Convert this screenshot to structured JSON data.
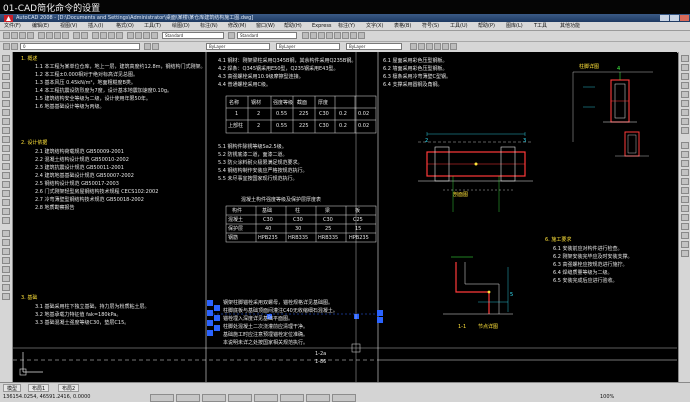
{
  "caption": "01-CAD简化命令的设置",
  "window": {
    "title": "AutoCAD 2008 - [D:\\Documents and Settings\\Administrator\\桌面\\某楼\\某仓库建筑结构施工图.dwg]"
  },
  "menu": {
    "items": [
      "文件(F)",
      "编辑(E)",
      "视图(V)",
      "插入(I)",
      "格式(O)",
      "工具(T)",
      "绘图(D)",
      "标注(N)",
      "修改(M)",
      "窗口(W)",
      "帮助(H)",
      "Express",
      "标注(Y)",
      "文字(X)",
      "表格(B)",
      "符号(S)",
      "工具(U)",
      "帮助(P)",
      "图库(L)",
      "T工具",
      "其他功能"
    ]
  },
  "toolbar": {
    "layer_combo": "0",
    "color_combo": "ByLayer",
    "linetype_combo": "ByLayer",
    "lineweight_combo": "ByLayer",
    "style_combo": "Standard"
  },
  "notes": {
    "section1": "1. 概述",
    "lines_left": [
      "1.1  本工程为某单位仓库，地上一层，建筑高度约12.8m，钢结构门式刚架。",
      "1.2  本工程±0.000相对于绝对标高详见总图。",
      "1.3  基本风压 0.45kN/m²，地面粗糙度B类。",
      "1.4  本工程抗震设防烈度为7度，设计基本地震加速度0.10g。",
      "1.5  建筑结构安全等级为二级，设计使用年限50年。",
      "1.6  地基基础设计等级为丙级。"
    ],
    "section2": "2. 设计依据",
    "lines_left2": [
      "2.1  建筑结构荷载规范 GB50009-2001",
      "2.2  混凝土结构设计规范 GB50010-2002",
      "2.3  建筑抗震设计规范 GB50011-2001",
      "2.4  建筑地基基础设计规范 GB50007-2002",
      "2.5  钢结构设计规范 GB50017-2003",
      "2.6  门式刚架轻型房屋钢结构技术规程 CECS102:2002",
      "2.7  冷弯薄壁型钢结构技术规范 GB50018-2002",
      "2.8  地质勘察报告"
    ],
    "section3": "3. 基础",
    "lines_left3": [
      "3.1  基础采用柱下独立基础，持力层为粉质粘土层。",
      "3.2  地基承载力特征值 fak=180kPa。",
      "3.3  基础混凝土强度等级C30，垫层C15。"
    ],
    "lines_mid": [
      "4.1  钢材：刚架梁柱采用Q345B钢，其余构件采用Q235B钢。",
      "4.2  焊条：Q345钢采用E50型，Q235钢采用E43型。",
      "4.3  高强螺栓采用10.9级摩擦型连接。",
      "4.4  普通螺栓采用C级。",
      "4.5  锚栓采用Q235钢。"
    ],
    "lines_mid2": [
      "5.1  钢构件除锈等级Sa2.5级。",
      "5.2  防锈底漆二道，面漆二道。",
      "5.3  防火涂料耐火极限满足规范要求。",
      "5.4  钢结构制作安装应严格按规范执行。",
      "5.5  未尽事宜按国家现行规范执行。"
    ],
    "lines_right": [
      "6.1  屋面采用彩色压型钢板。",
      "6.2  墙面采用彩色压型钢板。",
      "6.3  檩条采用冷弯薄壁C型钢。",
      "6.4  支撑采用圆钢及角钢。"
    ],
    "section_install": "6. 施工要求",
    "lines_install": [
      "6.1  安装前应对构件进行检查。",
      "6.2  刚架安装完毕应及时安装支撑。",
      "6.3  高强螺栓应按规范进行施拧。",
      "6.4  焊缝质量等级为二级。",
      "6.5  安装完成后应进行验收。"
    ],
    "table_headers": [
      "名称",
      "钢材",
      "强度等级",
      "截面",
      "厚度"
    ],
    "table_rows": [
      [
        "1",
        "2",
        "0.55",
        "225",
        "C30",
        "0.2",
        "0.02"
      ],
      [
        "上部柱",
        "2",
        "0.55",
        "225",
        "C30",
        "0.2",
        "0.02"
      ]
    ],
    "table2_title": "混凝土构件强度等级及保护层厚度表",
    "table2_headers": [
      "构件",
      "基础",
      "柱",
      "梁",
      "板"
    ],
    "table2_rows": [
      [
        "混凝土",
        "C30",
        "C30",
        "C30",
        "C25"
      ],
      [
        "保护层",
        "40",
        "30",
        "25",
        "15"
      ],
      [
        "钢筋",
        "HPB235",
        "HRB335",
        "HRB335",
        "HPB235"
      ]
    ],
    "detail_label_1": "1-1",
    "detail_label_2": "剖面图",
    "detail_label_3": "节点详图",
    "detail_label_4": "柱脚详图",
    "small_labels": [
      "2",
      "3",
      "4",
      "5"
    ],
    "selected_lines": [
      "钢架柱脚锚栓采用双螺母，锚栓规格详见基础图。",
      "柱脚底板与基础顶面间灌注C40无收缩细石混凝土。",
      "锚栓埋入深度详见基础平面图。",
      "柱脚处混凝土二次浇灌前应清理干净。",
      "基础施工时应注意预埋锚栓定位准确。",
      "本说明未详之处按国家相关规范执行。",
      "1-2a",
      "1-86"
    ]
  },
  "status": {
    "tabs": [
      "模型",
      "布局1",
      "布局2"
    ],
    "coords": "136154.0254, 46591.2416, 0.0000",
    "zoom": "100%"
  },
  "colors": {
    "canvas_bg": "#000000",
    "white_text": "#e6e6e6",
    "yellow": "#ffe23a",
    "green": "#43ff45",
    "cyan": "#35e7ff",
    "red": "#ff3a3a",
    "selection_blue": "#2a63ff"
  }
}
